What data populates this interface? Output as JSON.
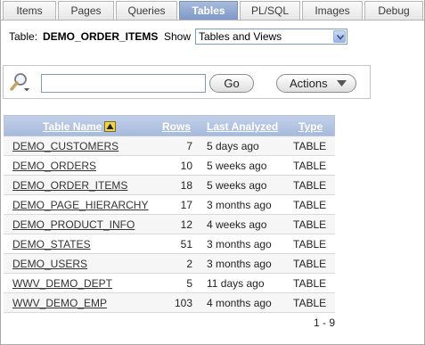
{
  "tabs": [
    {
      "label": "Items",
      "active": false
    },
    {
      "label": "Pages",
      "active": false
    },
    {
      "label": "Queries",
      "active": false
    },
    {
      "label": "Tables",
      "active": true
    },
    {
      "label": "PL/SQL",
      "active": false
    },
    {
      "label": "Images",
      "active": false
    },
    {
      "label": "Debug",
      "active": false
    }
  ],
  "selector": {
    "table_label": "Table:",
    "table_value": "DEMO_ORDER_ITEMS",
    "show_label": "Show",
    "show_value": "Tables and Views"
  },
  "search": {
    "input_value": "",
    "go_label": "Go",
    "actions_label": "Actions"
  },
  "report": {
    "headers": {
      "name": "Table Name",
      "rows": "Rows",
      "last_analyzed": "Last Analyzed",
      "type": "Type"
    },
    "rows": [
      {
        "name": "DEMO_CUSTOMERS",
        "rows": "7",
        "last_analyzed": "5 days ago",
        "type": "TABLE"
      },
      {
        "name": "DEMO_ORDERS",
        "rows": "10",
        "last_analyzed": "5 weeks ago",
        "type": "TABLE"
      },
      {
        "name": "DEMO_ORDER_ITEMS",
        "rows": "18",
        "last_analyzed": "5 weeks ago",
        "type": "TABLE"
      },
      {
        "name": "DEMO_PAGE_HIERARCHY",
        "rows": "17",
        "last_analyzed": "3 months ago",
        "type": "TABLE"
      },
      {
        "name": "DEMO_PRODUCT_INFO",
        "rows": "12",
        "last_analyzed": "4 weeks ago",
        "type": "TABLE"
      },
      {
        "name": "DEMO_STATES",
        "rows": "51",
        "last_analyzed": "3 months ago",
        "type": "TABLE"
      },
      {
        "name": "DEMO_USERS",
        "rows": "2",
        "last_analyzed": "3 months ago",
        "type": "TABLE"
      },
      {
        "name": "WWV_DEMO_DEPT",
        "rows": "5",
        "last_analyzed": "11 days ago",
        "type": "TABLE"
      },
      {
        "name": "WWV_DEMO_EMP",
        "rows": "103",
        "last_analyzed": "4 months ago",
        "type": "TABLE"
      }
    ],
    "pagination": "1 - 9"
  }
}
